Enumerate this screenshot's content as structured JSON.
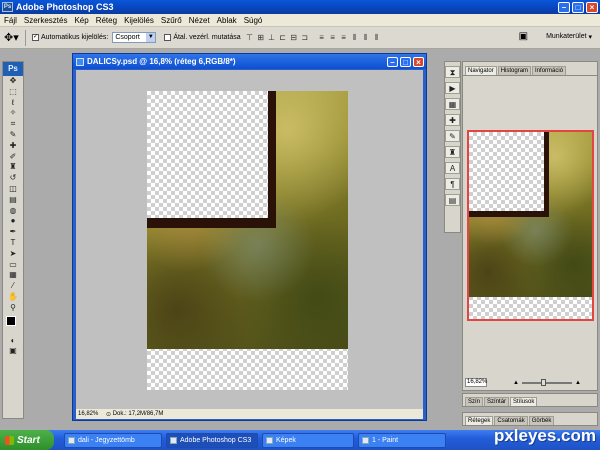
{
  "app": {
    "title": "Adobe Photoshop CS3",
    "logo": "Ps"
  },
  "menu": [
    "Fájl",
    "Szerkesztés",
    "Kép",
    "Réteg",
    "Kijelölés",
    "Szűrő",
    "Nézet",
    "Ablak",
    "Súgó"
  ],
  "options": {
    "auto_select_label": "Automatikus kijelölés:",
    "auto_select_checked": true,
    "group_select": "Csoport",
    "show_transform_label": "Átal. vezérl. mutatása",
    "show_transform_checked": false,
    "workspace_label": "Munkaterület"
  },
  "document": {
    "title": "DALICSy.psd @ 16,8% (réteg 6,RGB/8*)",
    "zoom": "16,82%",
    "doc_info": "Dok.: 17,2M/86,7M"
  },
  "navigator": {
    "tabs": [
      "Navigator",
      "Histogram",
      "Információ"
    ],
    "zoom": "16,82%"
  },
  "panels": {
    "color_tabs": [
      "Szín",
      "Színtár",
      "Stílusok"
    ],
    "layer_tabs": [
      "Rétegek",
      "Csatornák",
      "Görbék"
    ]
  },
  "taskbar": {
    "start": "Start",
    "tasks": [
      "dali - Jegyzettömb",
      "Adobe Photoshop CS3",
      "Képek",
      "1 - Paint"
    ]
  },
  "watermark": "pxleyes.com",
  "colors": {
    "xp_blue": "#245edb",
    "frame_brown": "#2b1208",
    "nav_highlight": "#e64343"
  }
}
